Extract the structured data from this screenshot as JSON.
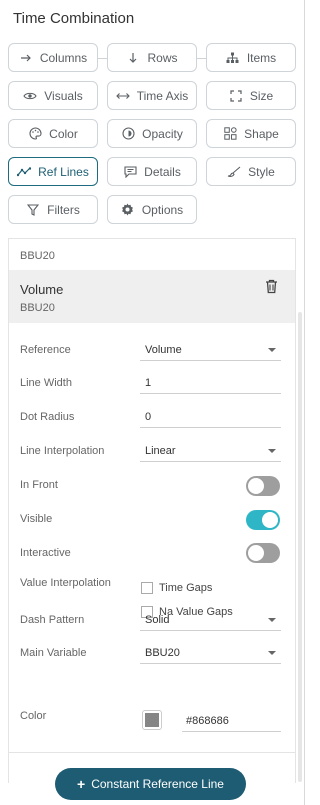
{
  "panel": {
    "title": "Time Combination"
  },
  "tabs": [
    {
      "key": "columns",
      "label": "Columns",
      "icon": "arrow-right-icon"
    },
    {
      "key": "rows",
      "label": "Rows",
      "icon": "arrow-down-icon"
    },
    {
      "key": "items",
      "label": "Items",
      "icon": "hierarchy-icon"
    },
    {
      "key": "visuals",
      "label": "Visuals",
      "icon": "eye-icon"
    },
    {
      "key": "time_axis",
      "label": "Time Axis",
      "icon": "double-arrow-icon"
    },
    {
      "key": "size",
      "label": "Size",
      "icon": "resize-corners-icon"
    },
    {
      "key": "color",
      "label": "Color",
      "icon": "palette-icon"
    },
    {
      "key": "opacity",
      "label": "Opacity",
      "icon": "opacity-icon"
    },
    {
      "key": "shape",
      "label": "Shape",
      "icon": "shapes-icon"
    },
    {
      "key": "ref_lines",
      "label": "Ref Lines",
      "icon": "line-chart-icon",
      "active": true
    },
    {
      "key": "details",
      "label": "Details",
      "icon": "comment-icon"
    },
    {
      "key": "style",
      "label": "Style",
      "icon": "brush-icon"
    },
    {
      "key": "filters",
      "label": "Filters",
      "icon": "filter-icon"
    },
    {
      "key": "options",
      "label": "Options",
      "icon": "gear-icon"
    }
  ],
  "previous_item": {
    "subtitle": "BBU20"
  },
  "ref_line": {
    "title": "Volume",
    "subtitle": "BBU20",
    "reference_label": "Reference",
    "reference_value": "Volume",
    "line_width_label": "Line Width",
    "line_width_value": "1",
    "dot_radius_label": "Dot Radius",
    "dot_radius_value": "0",
    "line_interpolation_label": "Line Interpolation",
    "line_interpolation_value": "Linear",
    "in_front_label": "In Front",
    "in_front": false,
    "visible_label": "Visible",
    "visible": true,
    "interactive_label": "Interactive",
    "interactive": false,
    "value_interpolation_label": "Value Interpolation",
    "time_gaps_label": "Time Gaps",
    "time_gaps": false,
    "na_value_gaps_label": "Na Value Gaps",
    "na_value_gaps": false,
    "dash_pattern_label": "Dash Pattern",
    "dash_pattern_value": "Solid",
    "main_variable_label": "Main Variable",
    "main_variable_value": "BBU20",
    "color_label": "Color",
    "color_value": "#868686"
  },
  "actions": {
    "add_constant_label": "Constant Reference Line"
  },
  "colors": {
    "accent": "#1d5c73",
    "toggle_on": "#2fb6c6",
    "toggle_off": "#9e9e9e"
  }
}
